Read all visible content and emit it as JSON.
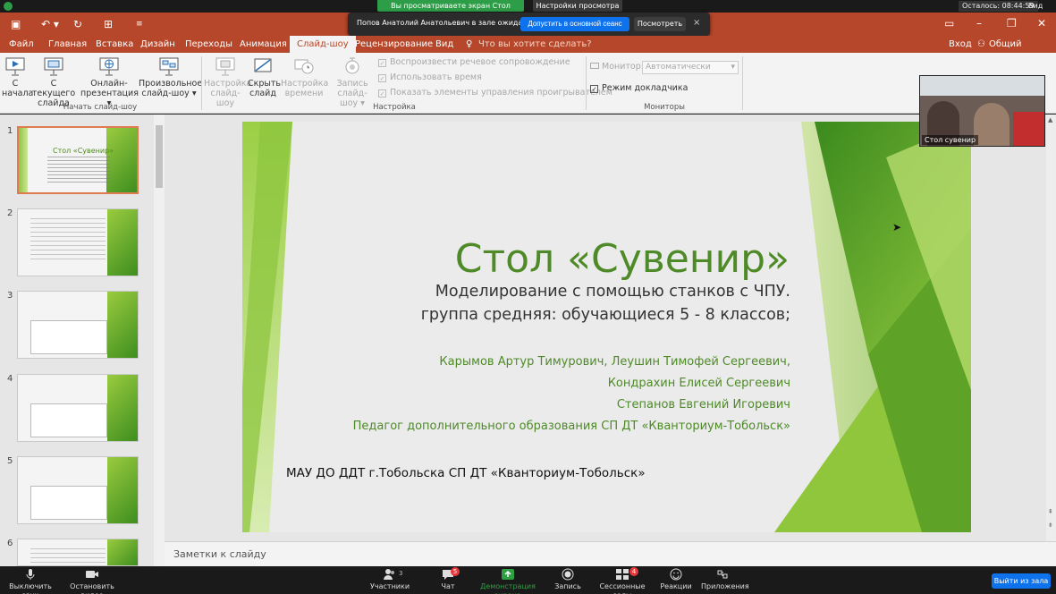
{
  "zoom_top": {
    "share_banner": "Вы просматриваете экран Стол сувенир",
    "view_options": "Настройки просмотра ⌄",
    "timer": "Осталось: 08:44:59",
    "view_button": "Вид"
  },
  "waiting_room": {
    "message": "Попов Анатолий Анатольевич в зале ожидания",
    "admit": "Допустить в основной сеанс",
    "view": "Посмотреть",
    "close": "×"
  },
  "tabs": [
    "Файл",
    "Главная",
    "Вставка",
    "Дизайн",
    "Переходы",
    "Анимация",
    "Слайд-шоу",
    "Рецензирование",
    "Вид"
  ],
  "active_tab": "Слайд-шоу",
  "tell_me": "Что вы хотите сделать?",
  "signin": "Вход",
  "share": "Общий доступ",
  "ribbon": {
    "from_start_1": "С",
    "from_start_2": "начала",
    "from_current_1": "С текущего",
    "from_current_2": "слайда",
    "online_1": "Онлайн-",
    "online_2": "презентация ▾",
    "custom_1": "Произвольное",
    "custom_2": "слайд-шоу ▾",
    "group_start": "Начать слайд-шоу",
    "setup_1": "Настройка",
    "setup_2": "слайд-шоу",
    "hide_1": "Скрыть",
    "hide_2": "слайд",
    "rehearse_1": "Настройка",
    "rehearse_2": "времени",
    "record_1": "Запись",
    "record_2": "слайд-шоу ▾",
    "chk_narration": "Воспроизвести речевое сопровождение",
    "chk_timings": "Использовать время",
    "chk_controls": "Показать элементы управления проигрывателем",
    "group_setup": "Настройка",
    "monitor_label": "Монитор:",
    "monitor_value": "Автоматически",
    "presenter_view": "Режим докладчика",
    "group_monitors": "Мониторы"
  },
  "thumbnails": {
    "numbers": [
      "1",
      "2",
      "3",
      "4",
      "5",
      "6"
    ],
    "slide1_title": "Стол «Сувенир»"
  },
  "slide": {
    "title": "Стол «Сувенир»",
    "subtitle_1": "Моделирование с помощью станков с ЧПУ.",
    "subtitle_2": "группа средняя: обучающиеся 5 - 8 классов;",
    "authors_1": "Карымов Артур Тимурович, Леушин Тимофей Сергеевич,",
    "authors_2": "Кондрахин Елисей Сергеевич",
    "authors_3": "Степанов Евгений Игоревич",
    "teacher": "Педагог дополнительного образования СП ДТ «Кванториум-Тобольск»",
    "organization": "МАУ ДО ДДТ г.Тобольска СП ДТ «Кванториум-Тобольск»"
  },
  "notes_placeholder": "Заметки к слайду",
  "video_tile": {
    "name": "Стол сувенир"
  },
  "zoom_bottom": {
    "mute": "Выключить звук",
    "video": "Остановить видео",
    "participants": "Участники",
    "participants_count": "3",
    "chat": "Чат",
    "chat_badge": "5",
    "share": "Демонстрация экрана",
    "record": "Запись",
    "breakout": "Сессионные залы",
    "breakout_badge": "4",
    "reactions": "Реакции",
    "apps": "Приложения",
    "leave": "Выйти из зала"
  },
  "colors": {
    "ppt_accent": "#b7472a",
    "slide_green": "#4e8a27",
    "zoom_blue": "#0e72ed",
    "share_green": "#2e9d48"
  }
}
